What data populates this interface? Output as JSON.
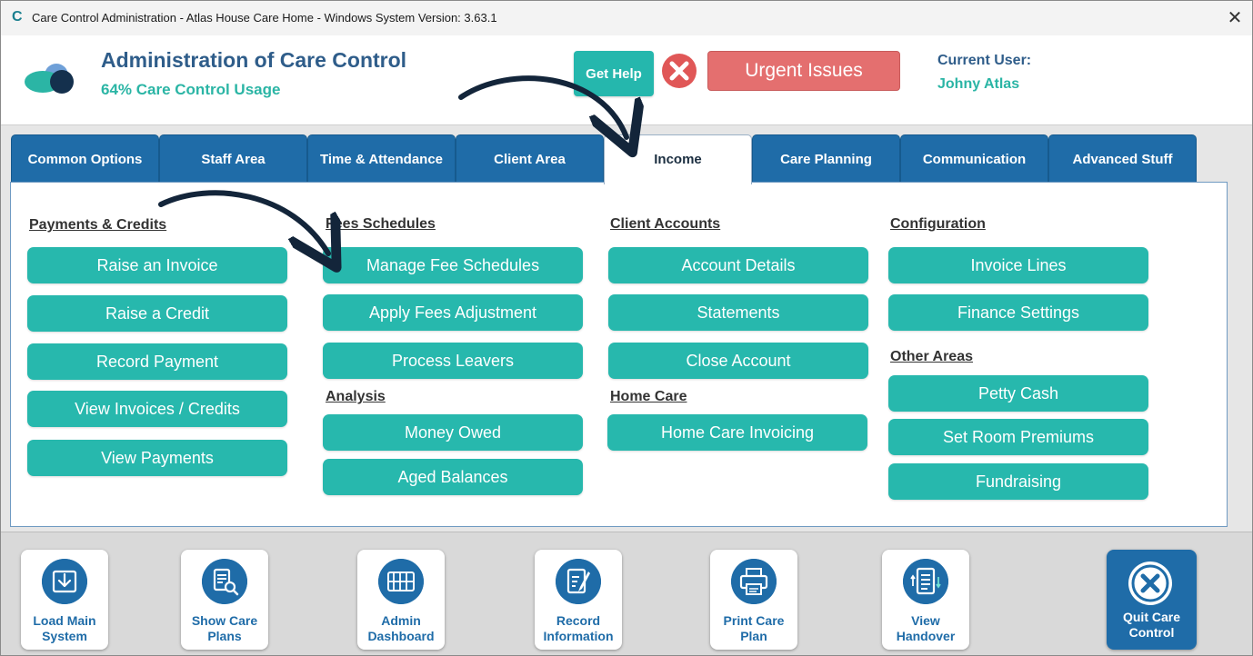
{
  "window": {
    "title": "Care Control Administration - Atlas House Care Home - Windows System Version: 3.63.1",
    "app_glyph": "C",
    "close_glyph": "✕"
  },
  "header": {
    "title": "Administration of Care Control",
    "usage": "64% Care Control Usage",
    "get_help": "Get Help",
    "urgent": "Urgent Issues",
    "current_user_label": "Current User:",
    "current_user_name": "Johny Atlas"
  },
  "tabs": [
    {
      "label": "Common Options"
    },
    {
      "label": "Staff Area"
    },
    {
      "label": "Time & Attendance"
    },
    {
      "label": "Client Area"
    },
    {
      "label": "Income"
    },
    {
      "label": "Care Planning"
    },
    {
      "label": "Communication"
    },
    {
      "label": "Advanced Stuff"
    }
  ],
  "active_tab": "Income",
  "sections": {
    "payments": {
      "title": "Payments & Credits",
      "items": [
        "Raise an Invoice",
        "Raise a Credit",
        "Record Payment",
        "View Invoices / Credits",
        "View Payments"
      ]
    },
    "fees": {
      "title": "Fees Schedules",
      "items": [
        "Manage Fee Schedules",
        "Apply Fees Adjustment",
        "Process Leavers"
      ]
    },
    "analysis": {
      "title": "Analysis",
      "items": [
        "Money Owed",
        "Aged Balances"
      ]
    },
    "accounts": {
      "title": "Client Accounts",
      "items": [
        "Account Details",
        "Statements",
        "Close Account"
      ]
    },
    "homecare": {
      "title": "Home Care",
      "items": [
        "Home Care Invoicing"
      ]
    },
    "config": {
      "title": "Configuration",
      "items": [
        "Invoice Lines",
        "Finance Settings"
      ]
    },
    "other": {
      "title": "Other Areas",
      "items": [
        "Petty Cash",
        "Set Room Premiums",
        "Fundraising"
      ]
    }
  },
  "toolbar": {
    "load": {
      "l1": "Load Main",
      "l2": "System",
      "icon": "download-box-icon"
    },
    "plans": {
      "l1": "Show Care",
      "l2": "Plans",
      "icon": "document-search-icon"
    },
    "dash": {
      "l1": "Admin",
      "l2": "Dashboard",
      "icon": "dashboard-grid-icon"
    },
    "record": {
      "l1": "Record",
      "l2": "Information",
      "icon": "edit-document-icon"
    },
    "print": {
      "l1": "Print Care",
      "l2": "Plan",
      "icon": "printer-icon"
    },
    "handover": {
      "l1": "View",
      "l2": "Handover",
      "icon": "handover-list-icon"
    },
    "quit": {
      "l1": "Quit Care",
      "l2": "Control",
      "icon": "close-circle-icon"
    }
  },
  "colors": {
    "accent": "#27b8ad",
    "tab_blue": "#1f6ca8",
    "urgent_red": "#e46f6f",
    "title_blue": "#2f5d8a"
  }
}
